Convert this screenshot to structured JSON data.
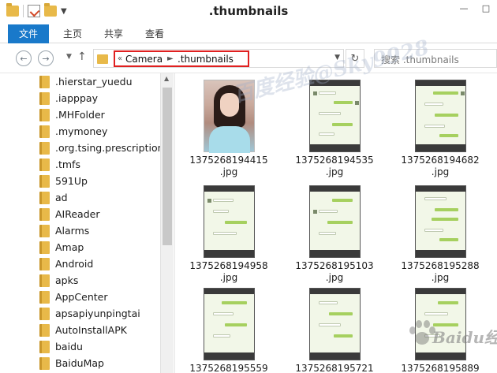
{
  "window": {
    "title": ".thumbnails",
    "minimize": "—",
    "maximize": "□",
    "close": "✕"
  },
  "ribbon": {
    "tabs": [
      "文件",
      "主页",
      "共享",
      "查看"
    ]
  },
  "nav": {
    "back_icon": "arrow-left-icon",
    "forward_icon": "arrow-right-icon",
    "up_arrow": "↑",
    "refresh": "↻",
    "overflow": "«",
    "breadcrumb": [
      "Camera",
      ".thumbnails"
    ],
    "search_placeholder": "搜索 .thumbnails"
  },
  "sidebar": {
    "items": [
      ".hierstar_yuedu",
      ".iapppay",
      ".MHFolder",
      ".mymoney",
      ".org.tsing.prescription",
      ".tmfs",
      "591Up",
      "ad",
      "AIReader",
      "Alarms",
      "Amap",
      "Android",
      "apks",
      "AppCenter",
      "apsapiyunpingtai",
      "AutoInstallAPK",
      "baidu",
      "BaiduMap"
    ]
  },
  "files": [
    {
      "line1": "1375268194415",
      "line2": ".jpg",
      "kind": "photo"
    },
    {
      "line1": "1375268194535",
      "line2": ".jpg",
      "kind": "chat"
    },
    {
      "line1": "1375268194682",
      "line2": ".jpg",
      "kind": "chat"
    },
    {
      "line1": "1375268194958",
      "line2": ".jpg",
      "kind": "chat"
    },
    {
      "line1": "1375268195103",
      "line2": ".jpg",
      "kind": "chat"
    },
    {
      "line1": "1375268195288",
      "line2": ".jpg",
      "kind": "chat"
    },
    {
      "line1": "1375268195559",
      "line2": "",
      "kind": "chat"
    },
    {
      "line1": "1375268195721",
      "line2": "",
      "kind": "chat"
    },
    {
      "line1": "1375268195889",
      "line2": "",
      "kind": "chat"
    }
  ],
  "watermark": {
    "text1": "百度经验@Sky9928",
    "text2": "Baidu经验"
  },
  "colors": {
    "ribbon_file_tab": "#1979ca",
    "breadcrumb_highlight": "#e02020",
    "folder": "#e8b949"
  }
}
